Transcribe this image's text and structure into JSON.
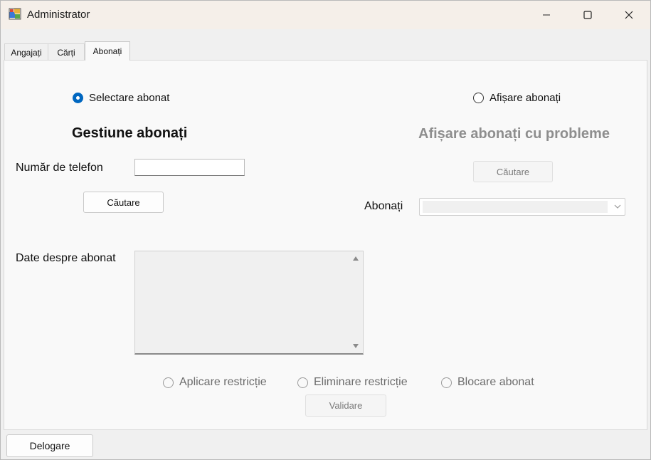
{
  "window": {
    "title": "Administrator"
  },
  "tabs": [
    {
      "label": "Angajați"
    },
    {
      "label": "Cărți"
    },
    {
      "label": "Abonați"
    }
  ],
  "left": {
    "radio_label": "Selectare abonat",
    "heading": "Gestiune abonați",
    "phone_label": "Număr de telefon",
    "phone_value": "",
    "search_button": "Căutare",
    "details_label": "Date despre abonat",
    "details_value": ""
  },
  "right": {
    "radio_label": "Afișare abonați",
    "heading": "Afișare abonați cu probleme",
    "search_button": "Căutare",
    "subscribers_label": "Abonați",
    "subscribers_value": ""
  },
  "actions": {
    "apply_restriction": "Aplicare restricție",
    "remove_restriction": "Eliminare restricție",
    "block_subscriber": "Blocare abonat",
    "validate_button": "Validare"
  },
  "footer": {
    "logout_button": "Delogare"
  },
  "colors": {
    "accent": "#0067c0",
    "disabled_text": "#8e8e8e"
  }
}
